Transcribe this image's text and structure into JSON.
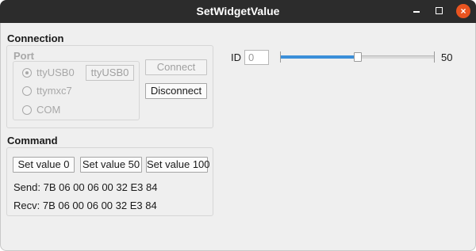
{
  "window": {
    "title": "SetWidgetValue",
    "minimize_icon": "minimize-icon",
    "maximize_icon": "maximize-icon",
    "close_icon": "close-icon",
    "close_glyph": "×",
    "accent": "#e95420"
  },
  "connection": {
    "heading": "Connection",
    "port": {
      "label": "Port",
      "options": [
        {
          "label": "ttyUSB0",
          "checked": true
        },
        {
          "label": "ttymxc7",
          "checked": false
        },
        {
          "label": "COM",
          "checked": false
        }
      ],
      "custom_port_value": "ttyUSB0"
    },
    "connect_label": "Connect",
    "disconnect_label": "Disconnect"
  },
  "command": {
    "heading": "Command",
    "buttons": [
      "Set value 0",
      "Set value 50",
      "Set value 100"
    ],
    "send": "Send: 7B 06 00 06 00 32 E3 84",
    "recv": "Recv: 7B 06 00 06 00 32 E3 84"
  },
  "widget": {
    "id_label": "ID",
    "id_placeholder": "0",
    "slider_min": 0,
    "slider_max": 100,
    "slider_value": 50,
    "value_text": "50",
    "slider_fill_color": "#3b8fd9"
  }
}
